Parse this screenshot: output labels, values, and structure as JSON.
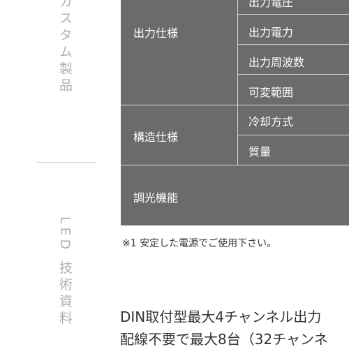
{
  "side_nav": {
    "top_item": "カスタム製品",
    "bottom_item": "LED 技術資料"
  },
  "spec_table": {
    "output_spec": {
      "label": "出力仕様",
      "rows": [
        "出力電圧",
        "出力電力",
        "出力周波数",
        "可変範囲"
      ]
    },
    "structure_spec": {
      "label": "構造仕様",
      "rows": [
        "冷却方式",
        "質量"
      ]
    },
    "dimming": {
      "label": "調光機能"
    }
  },
  "note": "※1 安定した電源でご使用下さい。",
  "description": {
    "line1": "DIN取付型最大4チャンネル出力",
    "line2": "配線不要で最大8台（32チャンネ"
  }
}
